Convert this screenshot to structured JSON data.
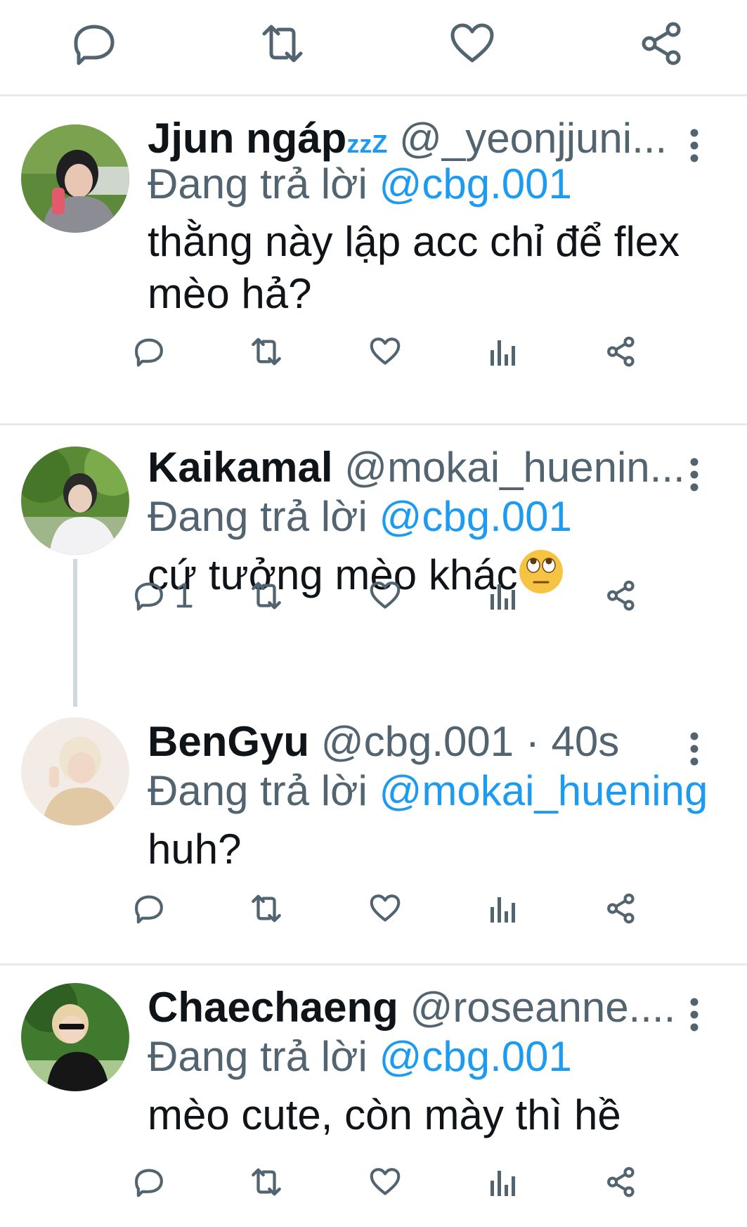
{
  "topbar": {
    "icons": [
      "reply-icon",
      "retweet-icon",
      "like-icon",
      "share-icon"
    ]
  },
  "replying_label": "Đang trả lời",
  "tweets": [
    {
      "name": "Jjun ngáp",
      "name_suffix": "zzZ",
      "handle": "@_yeonjjuni...",
      "time": "",
      "reply_to": "@cbg.001",
      "text_lines": [
        "thằng này lập acc chỉ để flex",
        "mèo hả?"
      ],
      "reply_count": "",
      "avatar_colors": [
        "#3f6a2c",
        "#8fb06b",
        "#d9d4cf"
      ]
    },
    {
      "name": "Kaikamal",
      "name_suffix": "",
      "handle": "@mokai_huenin...",
      "time": "",
      "reply_to": "@cbg.001",
      "text_lines": [
        "cứ tưởng mèo khác"
      ],
      "emoji": "eye-roll-emoji",
      "reply_count": "1",
      "avatar_colors": [
        "#4d7f2f",
        "#a9c98a",
        "#e8e8ea"
      ]
    },
    {
      "name": "BenGyu",
      "name_suffix": "",
      "handle": "@cbg.001",
      "time": " · 40s",
      "reply_to": "@mokai_huening",
      "text_lines": [
        "huh?"
      ],
      "reply_count": "",
      "avatar_colors": [
        "#efe6dc",
        "#d9c2a5",
        "#c9a27c"
      ]
    },
    {
      "name": "Chaechaeng",
      "name_suffix": "",
      "handle": "@roseanne....",
      "time": "",
      "reply_to": "@cbg.001",
      "text_lines": [
        "mèo cute, còn mày thì hề"
      ],
      "reply_count": "",
      "avatar_colors": [
        "#2f5c25",
        "#7fae5a",
        "#1a1a1a"
      ]
    }
  ],
  "colors": {
    "text": "#0f1419",
    "secondary": "#536471",
    "accent": "#1d9bf0",
    "divider": "#e7e9ea"
  }
}
